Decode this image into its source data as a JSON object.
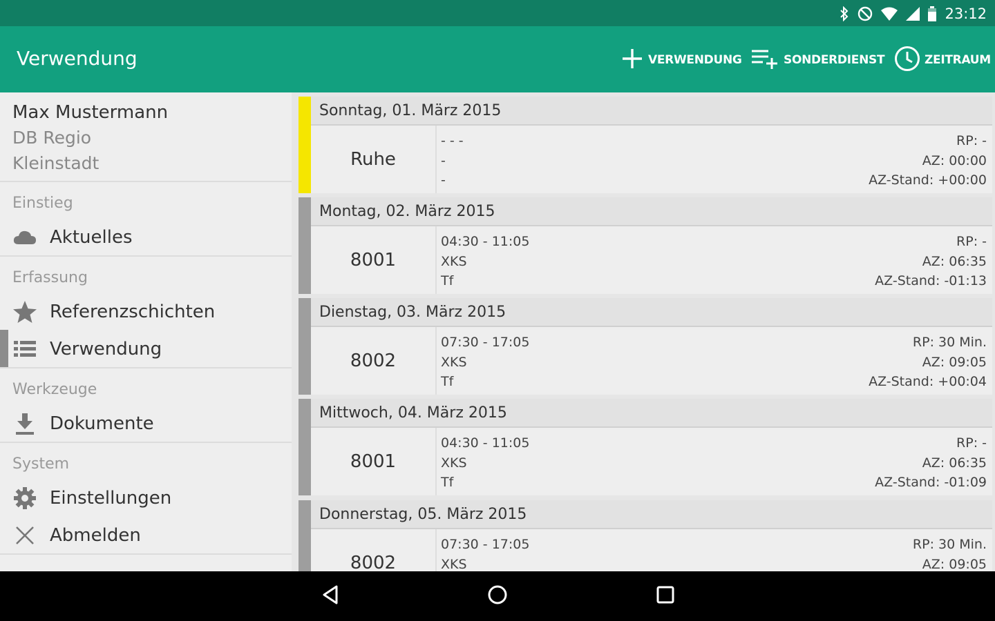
{
  "status_bar": {
    "time": "23:12",
    "icons": [
      "bluetooth-icon",
      "do-not-disturb-icon",
      "wifi-icon",
      "signal-icon",
      "battery-icon"
    ]
  },
  "toolbar": {
    "title": "Verwendung",
    "actions": [
      {
        "label": "VERWENDUNG",
        "icon": "plus-icon"
      },
      {
        "label": "SONDERDIENST",
        "icon": "playlist-add-icon"
      },
      {
        "label": "ZEITRAUM",
        "icon": "clock-icon"
      }
    ]
  },
  "drawer": {
    "profile": {
      "name": "Max Mustermann",
      "organization": "DB Regio",
      "location": "Kleinstadt"
    },
    "sections": [
      {
        "title": "Einstieg",
        "items": [
          {
            "label": "Aktuelles",
            "icon": "cloud-icon"
          }
        ]
      },
      {
        "title": "Erfassung",
        "items": [
          {
            "label": "Referenzschichten",
            "icon": "star-icon"
          },
          {
            "label": "Verwendung",
            "icon": "list-icon",
            "active": true
          }
        ]
      },
      {
        "title": "Werkzeuge",
        "items": [
          {
            "label": "Dokumente",
            "icon": "download-icon"
          }
        ]
      },
      {
        "title": "System",
        "items": [
          {
            "label": "Einstellungen",
            "icon": "gear-icon"
          },
          {
            "label": "Abmelden",
            "icon": "close-icon"
          }
        ]
      }
    ]
  },
  "days": [
    {
      "date": "Sonntag, 01. März 2015",
      "code": "Ruhe",
      "time": "- - -",
      "location": "-",
      "role": "-",
      "rp": "RP: -",
      "az": "AZ: 00:00",
      "az_stand": "AZ-Stand: +00:00",
      "type": "rest"
    },
    {
      "date": "Montag, 02. März 2015",
      "code": "8001",
      "time": "04:30 - 11:05",
      "location": "XKS",
      "role": "Tf",
      "rp": "RP: -",
      "az": "AZ: 06:35",
      "az_stand": "AZ-Stand: -01:13",
      "type": "work"
    },
    {
      "date": "Dienstag, 03. März 2015",
      "code": "8002",
      "time": "07:30 - 17:05",
      "location": "XKS",
      "role": "Tf",
      "rp": "RP: 30 Min.",
      "az": "AZ: 09:05",
      "az_stand": "AZ-Stand: +00:04",
      "type": "work"
    },
    {
      "date": "Mittwoch, 04. März 2015",
      "code": "8001",
      "time": "04:30 - 11:05",
      "location": "XKS",
      "role": "Tf",
      "rp": "RP: -",
      "az": "AZ: 06:35",
      "az_stand": "AZ-Stand: -01:09",
      "type": "work"
    },
    {
      "date": "Donnerstag, 05. März 2015",
      "code": "8002",
      "time": "07:30 - 17:05",
      "location": "XKS",
      "role": "",
      "rp": "RP: 30 Min.",
      "az": "AZ: 09:05",
      "az_stand": "",
      "type": "work"
    }
  ],
  "colors": {
    "status_bar": "#117e63",
    "toolbar": "#12a07f",
    "rest_stripe": "#f5e600",
    "work_stripe": "#9e9e9e"
  },
  "nav_bar": {
    "icons": [
      "back-icon",
      "home-icon",
      "recents-icon"
    ]
  }
}
